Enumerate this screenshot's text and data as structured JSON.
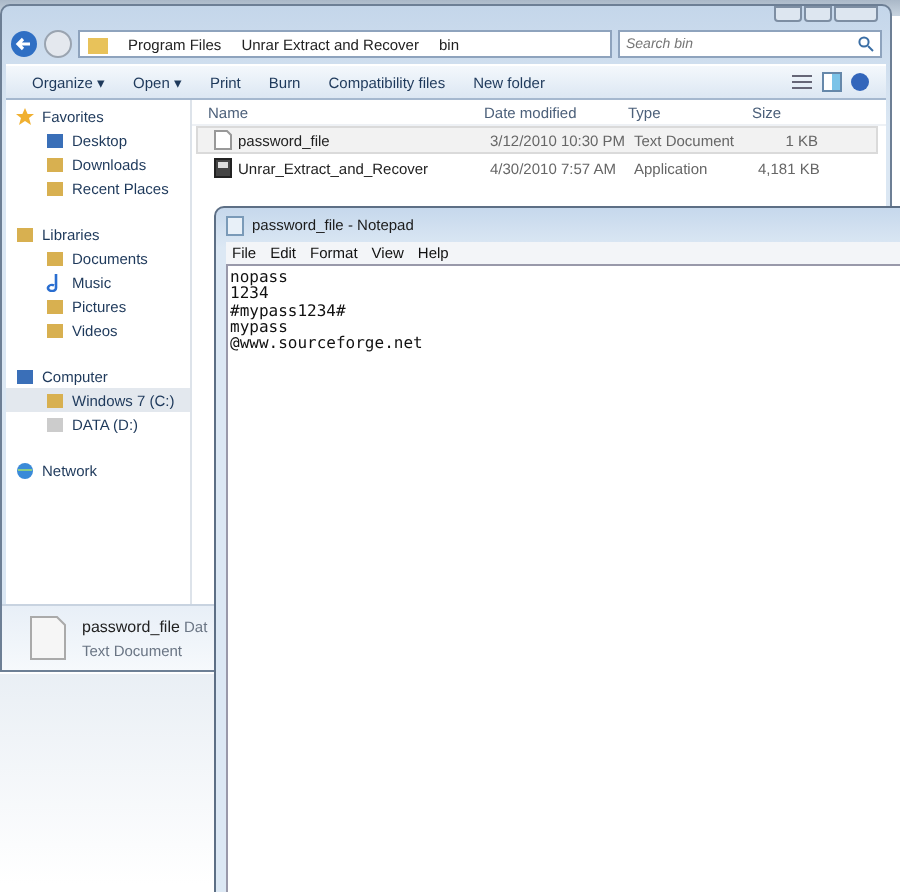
{
  "explorer": {
    "breadcrumb": [
      "Program Files",
      "Unrar Extract and Recover",
      "bin"
    ],
    "search": {
      "placeholder": "Search bin"
    },
    "toolbar": [
      "Organize ▾",
      "Open ▾",
      "Print",
      "Burn",
      "Compatibility files",
      "New folder"
    ],
    "sidebar": [
      {
        "label": "Favorites",
        "kind": "group",
        "selected": false
      },
      {
        "label": "Desktop",
        "kind": "item",
        "selected": false
      },
      {
        "label": "Downloads",
        "kind": "item",
        "selected": false
      },
      {
        "label": "Recent Places",
        "kind": "item",
        "selected": false
      },
      {
        "label": "Libraries",
        "kind": "group",
        "selected": false
      },
      {
        "label": "Documents",
        "kind": "item",
        "selected": false
      },
      {
        "label": "Music",
        "kind": "item",
        "selected": false
      },
      {
        "label": "Pictures",
        "kind": "item",
        "selected": false
      },
      {
        "label": "Videos",
        "kind": "item",
        "selected": false
      },
      {
        "label": "Computer",
        "kind": "group",
        "selected": false
      },
      {
        "label": "Windows 7 (C:)",
        "kind": "item",
        "selected": true
      },
      {
        "label": "DATA (D:)",
        "kind": "item",
        "selected": false
      },
      {
        "label": "Network",
        "kind": "group",
        "selected": false
      }
    ],
    "columns": [
      "Name",
      "Date modified",
      "Type",
      "Size"
    ],
    "rows": [
      {
        "name": "password_file",
        "date": "3/12/2010 10:30 PM",
        "type": "Text Document",
        "size": "1 KB",
        "selected": true
      },
      {
        "name": "Unrar_Extract_and_Recover",
        "date": "4/30/2010 7:57 AM",
        "type": "Application",
        "size": "4,181 KB",
        "selected": false
      }
    ],
    "details": {
      "name": "password_file",
      "field": "Dat",
      "type": "Text Document"
    }
  },
  "notepad": {
    "title": "password_file - Notepad",
    "menu": [
      "File",
      "Edit",
      "Format",
      "View",
      "Help"
    ],
    "lines": [
      "nopass",
      "1234",
      "#mypass1234#",
      "mypass",
      "@www.sourceforge.net"
    ]
  }
}
